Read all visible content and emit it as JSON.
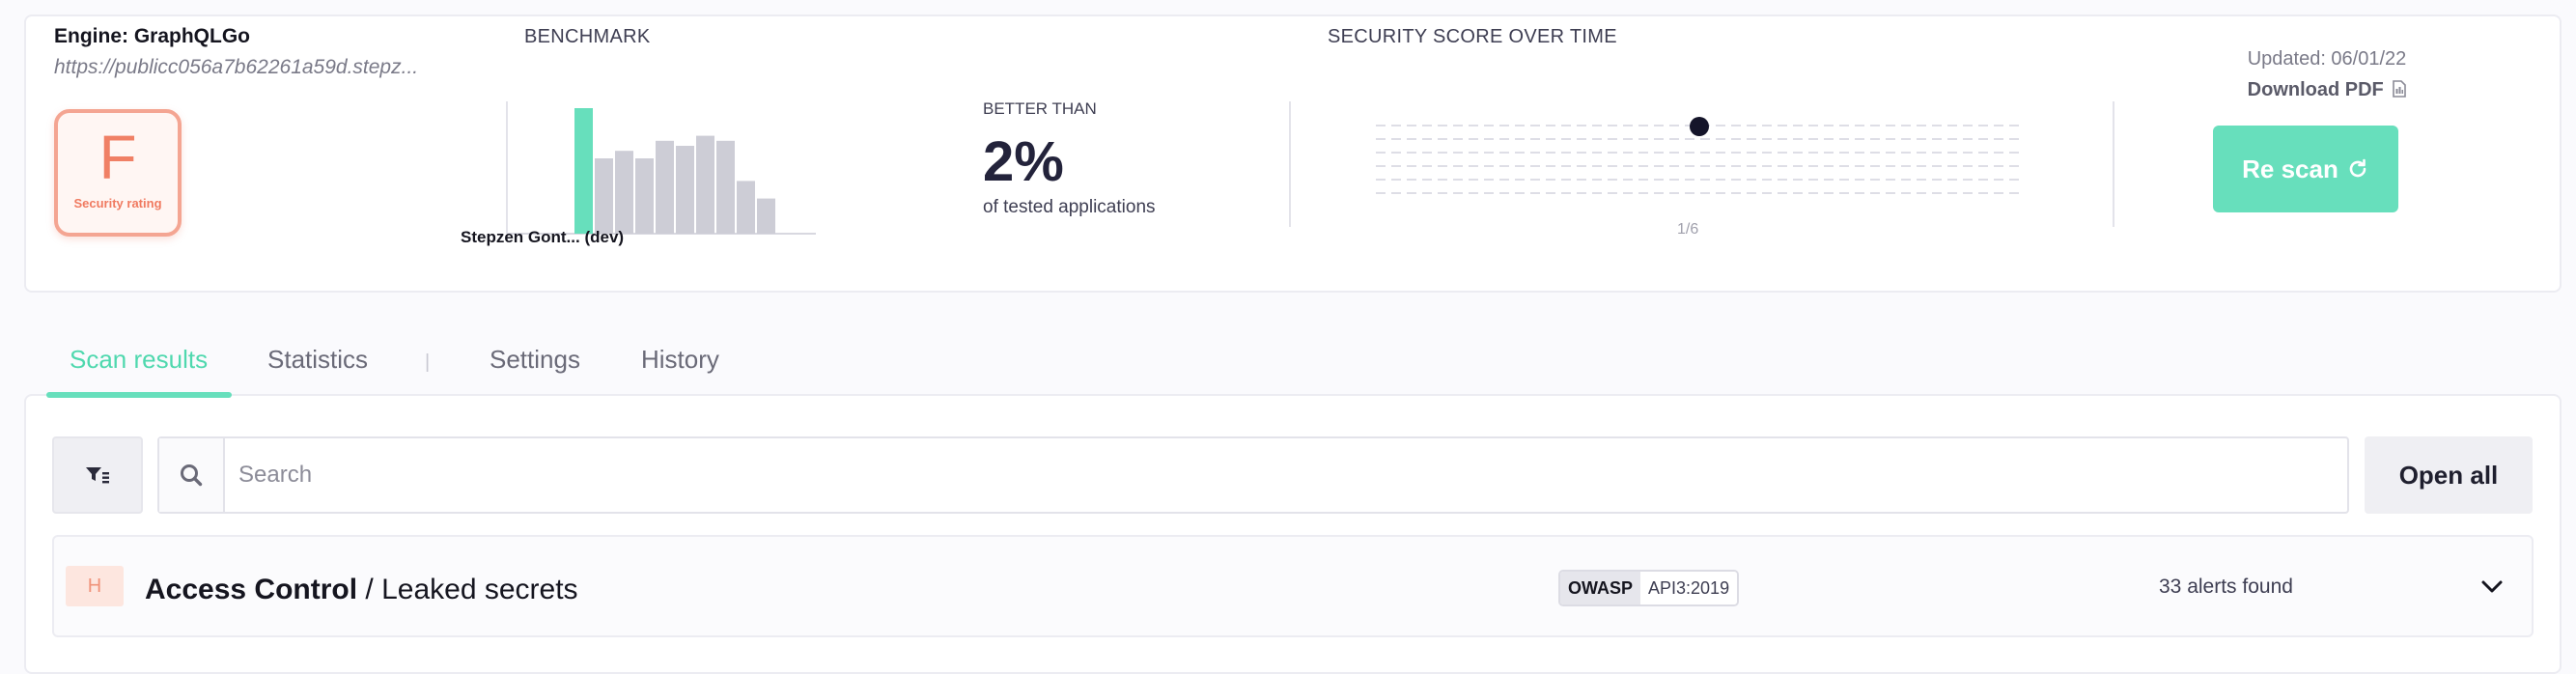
{
  "header": {
    "engine_title": "Engine: GraphQLGo",
    "engine_url": "https://publicc056a7b62261a59d.stepz...",
    "rating": {
      "grade": "F",
      "label": "Security rating"
    },
    "benchmark": {
      "label": "BENCHMARK",
      "caption": "Stepzen Gont... (dev)",
      "bars": [
        1.0,
        0.6,
        0.66,
        0.6,
        0.74,
        0.7,
        0.78,
        0.74,
        0.42,
        0.28
      ],
      "highlight_index": 0,
      "highlight_color": "#67dfbc",
      "bar_color": "#cdcdd6"
    },
    "better_than": {
      "label": "BETTER THAN",
      "value": "2%",
      "description": "of tested applications"
    },
    "score_over_time": {
      "label": "SECURITY SCORE OVER TIME",
      "page": "1/6",
      "point_fraction": 0.5
    },
    "updated": "Updated: 06/01/22",
    "download_pdf": "Download PDF",
    "rescan": "Re scan"
  },
  "tabs": [
    {
      "label": "Scan results",
      "active": true
    },
    {
      "label": "Statistics",
      "active": false
    },
    {
      "label": "Settings",
      "active": false
    },
    {
      "label": "History",
      "active": false
    }
  ],
  "toolbar": {
    "search_placeholder": "Search",
    "open_all": "Open all"
  },
  "results": [
    {
      "severity": "H",
      "category": "Access Control",
      "subcategory": " / Leaked secrets",
      "tag_key": "OWASP",
      "tag_value": "API3:2019",
      "alerts": "33 alerts found"
    }
  ],
  "colors": {
    "accent": "#67dfbc",
    "rating_red": "#f08065"
  },
  "icons": [
    "filter-icon",
    "search-icon",
    "refresh-icon",
    "pdf-icon",
    "chevron-down-icon"
  ]
}
